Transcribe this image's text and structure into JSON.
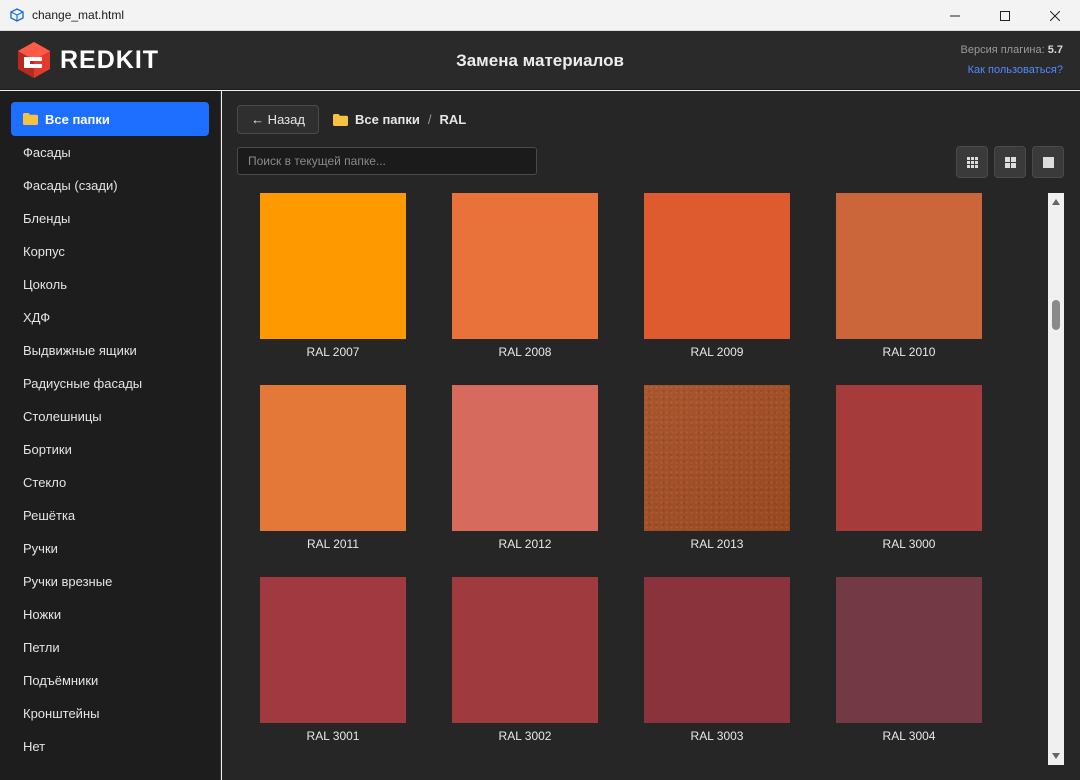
{
  "window": {
    "title": "change_mat.html",
    "icon": "sketchup-icon"
  },
  "header": {
    "logo_text": "REDKIT",
    "title": "Замена материалов",
    "version_label": "Версия плагина:",
    "version_value": "5.7",
    "help_link": "Как пользоваться?"
  },
  "sidebar": {
    "items": [
      {
        "label": "Все папки",
        "active": true
      },
      {
        "label": "Фасады"
      },
      {
        "label": "Фасады (сзади)"
      },
      {
        "label": "Бленды"
      },
      {
        "label": "Корпус"
      },
      {
        "label": "Цоколь"
      },
      {
        "label": "ХДФ"
      },
      {
        "label": "Выдвижные ящики"
      },
      {
        "label": "Радиусные фасады"
      },
      {
        "label": "Столешницы"
      },
      {
        "label": "Бортики"
      },
      {
        "label": "Стекло"
      },
      {
        "label": "Решётка"
      },
      {
        "label": "Ручки"
      },
      {
        "label": "Ручки врезные"
      },
      {
        "label": "Ножки"
      },
      {
        "label": "Петли"
      },
      {
        "label": "Подъёмники"
      },
      {
        "label": "Кронштейны"
      },
      {
        "label": "Нет"
      }
    ]
  },
  "toolbar": {
    "back_label": "← Назад",
    "breadcrumb": [
      "Все папки",
      "RAL"
    ],
    "search_placeholder": "Поиск в текущей папке...",
    "view_modes": [
      "small-grid-icon",
      "medium-grid-icon",
      "large-grid-icon"
    ]
  },
  "materials": [
    {
      "name": "RAL 2007",
      "color": "#FF9900"
    },
    {
      "name": "RAL 2008",
      "color": "#E8723A"
    },
    {
      "name": "RAL 2009",
      "color": "#DE5B30"
    },
    {
      "name": "RAL 2010",
      "color": "#CB663A"
    },
    {
      "name": "RAL 2011",
      "color": "#E47839"
    },
    {
      "name": "RAL 2012",
      "color": "#D66A5C"
    },
    {
      "name": "RAL 2013",
      "color": "#A54D22",
      "textured": true
    },
    {
      "name": "RAL 3000",
      "color": "#A63B3C"
    },
    {
      "name": "RAL 3001",
      "color": "#A03A40"
    },
    {
      "name": "RAL 3002",
      "color": "#9F3A3F"
    },
    {
      "name": "RAL 3003",
      "color": "#8A333C"
    },
    {
      "name": "RAL 3004",
      "color": "#733A45"
    }
  ],
  "colors": {
    "accent": "#1E6FFF",
    "link": "#4C8DFF",
    "folder": "#F5C242"
  }
}
